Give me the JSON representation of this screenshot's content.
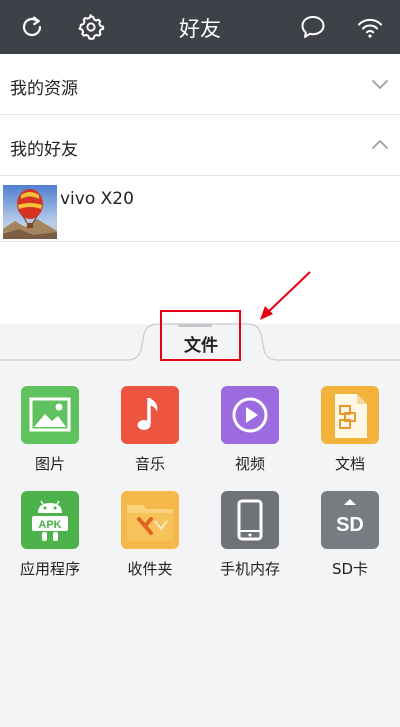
{
  "header": {
    "title": "好友",
    "icons": [
      "refresh-icon",
      "gear-icon",
      "chat-icon",
      "wifi-icon"
    ]
  },
  "sections": {
    "resources_label": "我的资源",
    "friends_label": "我的好友"
  },
  "device": {
    "name": "vivo X20",
    "thumbnail": "hot-air-balloon"
  },
  "tab": {
    "label": "文件"
  },
  "files": [
    {
      "label": "图片",
      "icon": "image-icon",
      "color": "#5dc05e"
    },
    {
      "label": "音乐",
      "icon": "music-icon",
      "color": "#ee5440"
    },
    {
      "label": "视频",
      "icon": "video-icon",
      "color": "#9b6be0"
    },
    {
      "label": "文档",
      "icon": "document-icon",
      "color": "#f2b33c"
    },
    {
      "label": "应用程序",
      "icon": "android-apk-icon",
      "color": "#4bb24c"
    },
    {
      "label": "收件夹",
      "icon": "inbox-folder-icon",
      "color": "#f6b84a"
    },
    {
      "label": "手机内存",
      "icon": "phone-storage-icon",
      "color": "#6f7377"
    },
    {
      "label": "SD卡",
      "icon": "sd-card-icon",
      "color": "#767a80"
    }
  ],
  "accent": "#e60012"
}
